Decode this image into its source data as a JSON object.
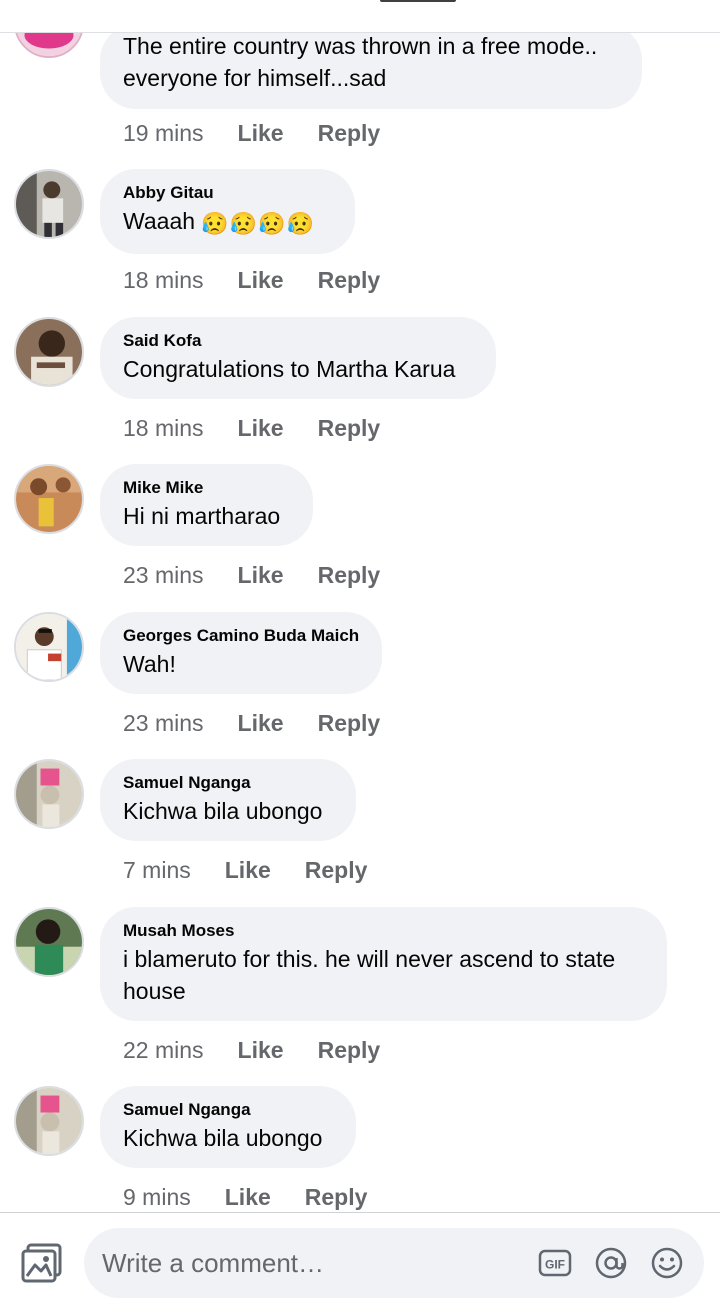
{
  "comments": [
    {
      "author": "",
      "text": "The entire country was thrown in a free mode.. everyone for himself...sad",
      "time": "19 mins",
      "like": "Like",
      "reply": "Reply"
    },
    {
      "author": "Abby Gitau",
      "text": "Waaah",
      "emoji": "😥😥😥😥",
      "time": "18 mins",
      "like": "Like",
      "reply": "Reply"
    },
    {
      "author": "Said Kofa",
      "text": "Congratulations to Martha Karua",
      "time": "18 mins",
      "like": "Like",
      "reply": "Reply"
    },
    {
      "author": "Mike Mike",
      "text": "Hi ni martharao",
      "time": "23 mins",
      "like": "Like",
      "reply": "Reply"
    },
    {
      "author": "Georges Camino Buda Maich",
      "text": "Wah!",
      "time": "23 mins",
      "like": "Like",
      "reply": "Reply"
    },
    {
      "author": "Samuel Nganga",
      "text": "Kichwa bila ubongo",
      "time": "7 mins",
      "like": "Like",
      "reply": "Reply"
    },
    {
      "author": "Musah Moses",
      "text": "i blameruto for this. he will never ascend to state house",
      "time": "22 mins",
      "like": "Like",
      "reply": "Reply"
    },
    {
      "author": "Samuel Nganga",
      "text": "Kichwa bila ubongo",
      "time": "9 mins",
      "like": "Like",
      "reply": "Reply"
    }
  ],
  "composer": {
    "placeholder": "Write a comment…",
    "photo_icon": "photo-icon",
    "gif_icon": "gif-icon",
    "gif_label": "GIF",
    "mention_icon": "at-sign-icon",
    "emoji_icon": "smiley-icon"
  },
  "colors": {
    "bubble": "#f0f2f5",
    "meta_text": "#65676b",
    "body_text": "#050505"
  }
}
